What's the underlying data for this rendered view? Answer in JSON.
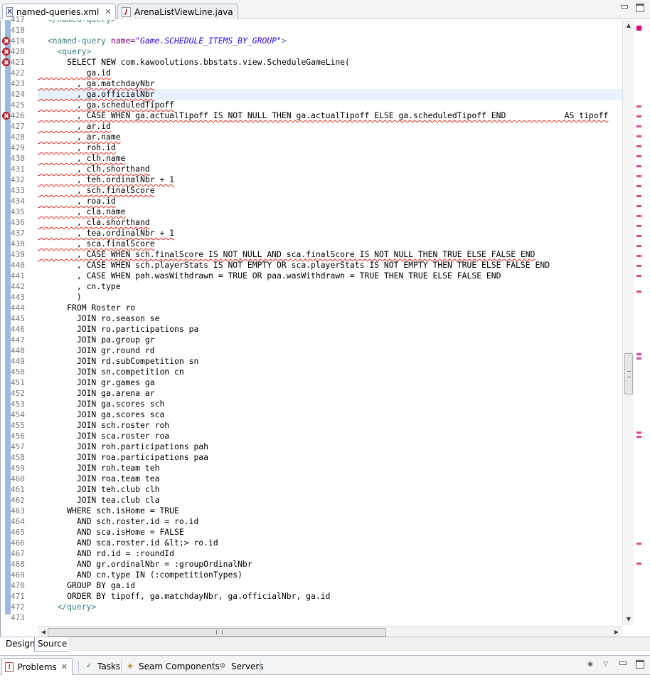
{
  "editor_tabs": [
    {
      "label": "named-queries.xml",
      "icon": "xml-file-icon",
      "active": true
    },
    {
      "label": "ArenaListViewLine.java",
      "icon": "java-file-icon",
      "active": false
    }
  ],
  "lines": [
    {
      "n": "417",
      "err": false,
      "sq": false,
      "text": "  </named-query>"
    },
    {
      "n": "418",
      "err": false,
      "sq": false,
      "text": ""
    },
    {
      "n": "419",
      "err": true,
      "sq": false,
      "kind": "nq-open"
    },
    {
      "n": "420",
      "err": true,
      "sq": false,
      "kind": "query-open"
    },
    {
      "n": "421",
      "err": true,
      "sq": false,
      "text": "      SELECT NEW com.kawoolutions.bbstats.view.ScheduleGameLine("
    },
    {
      "n": "422",
      "err": false,
      "sq": true,
      "text": "          ga.id"
    },
    {
      "n": "423",
      "err": false,
      "sq": true,
      "text": "        , ga.matchdayNbr"
    },
    {
      "n": "424",
      "err": false,
      "sq": true,
      "text": "        , ga.officialNbr"
    },
    {
      "n": "425",
      "err": false,
      "sq": true,
      "text": "        , ga.scheduledTipoff"
    },
    {
      "n": "426",
      "err": true,
      "sq": true,
      "text": "        , CASE WHEN ga.actualTipoff IS NOT NULL THEN ga.actualTipoff ELSE ga.scheduledTipoff END            AS tipoff"
    },
    {
      "n": "427",
      "err": false,
      "sq": true,
      "text": "        , ar.id"
    },
    {
      "n": "428",
      "err": false,
      "sq": true,
      "text": "        , ar.name"
    },
    {
      "n": "429",
      "err": false,
      "sq": true,
      "text": "        , roh.id"
    },
    {
      "n": "430",
      "err": false,
      "sq": true,
      "text": "        , clh.name"
    },
    {
      "n": "431",
      "err": false,
      "sq": true,
      "text": "        , clh.shorthand"
    },
    {
      "n": "432",
      "err": false,
      "sq": true,
      "text": "        , teh.ordinalNbr + 1"
    },
    {
      "n": "433",
      "err": false,
      "sq": true,
      "text": "        , sch.finalScore"
    },
    {
      "n": "434",
      "err": false,
      "sq": true,
      "text": "        , roa.id"
    },
    {
      "n": "435",
      "err": false,
      "sq": true,
      "text": "        , cla.name"
    },
    {
      "n": "436",
      "err": false,
      "sq": true,
      "text": "        , cla.shorthand"
    },
    {
      "n": "437",
      "err": false,
      "sq": true,
      "text": "        , tea.ordinalNbr + 1"
    },
    {
      "n": "438",
      "err": false,
      "sq": true,
      "text": "        , sca.finalScore"
    },
    {
      "n": "439",
      "err": false,
      "sq": true,
      "text": "        , CASE WHEN sch.finalScore IS NOT NULL AND sca.finalScore IS NOT NULL THEN TRUE ELSE FALSE END"
    },
    {
      "n": "440",
      "err": false,
      "sq": false,
      "text": "        , CASE WHEN sch.playerStats IS NOT EMPTY OR sca.playerStats IS NOT EMPTY THEN TRUE ELSE FALSE END"
    },
    {
      "n": "441",
      "err": false,
      "sq": false,
      "text": "        , CASE WHEN pah.wasWithdrawn = TRUE OR paa.wasWithdrawn = TRUE THEN TRUE ELSE FALSE END"
    },
    {
      "n": "442",
      "err": false,
      "sq": false,
      "text": "        , cn.type"
    },
    {
      "n": "443",
      "err": false,
      "sq": false,
      "text": "        )"
    },
    {
      "n": "444",
      "err": false,
      "sq": false,
      "text": "      FROM Roster ro"
    },
    {
      "n": "445",
      "err": false,
      "sq": false,
      "text": "        JOIN ro.season se"
    },
    {
      "n": "446",
      "err": false,
      "sq": false,
      "text": "        JOIN ro.participations pa"
    },
    {
      "n": "447",
      "err": false,
      "sq": false,
      "text": "        JOIN pa.group gr"
    },
    {
      "n": "448",
      "err": false,
      "sq": false,
      "text": "        JOIN gr.round rd"
    },
    {
      "n": "449",
      "err": false,
      "sq": false,
      "text": "        JOIN rd.subCompetition sn"
    },
    {
      "n": "450",
      "err": false,
      "sq": false,
      "text": "        JOIN sn.competition cn"
    },
    {
      "n": "451",
      "err": false,
      "sq": false,
      "text": "        JOIN gr.games ga"
    },
    {
      "n": "452",
      "err": false,
      "sq": false,
      "text": "        JOIN ga.arena ar"
    },
    {
      "n": "453",
      "err": false,
      "sq": false,
      "text": "        JOIN ga.scores sch"
    },
    {
      "n": "454",
      "err": false,
      "sq": false,
      "text": "        JOIN ga.scores sca"
    },
    {
      "n": "455",
      "err": false,
      "sq": false,
      "text": "        JOIN sch.roster roh"
    },
    {
      "n": "456",
      "err": false,
      "sq": false,
      "text": "        JOIN sca.roster roa"
    },
    {
      "n": "457",
      "err": false,
      "sq": false,
      "text": "        JOIN roh.participations pah"
    },
    {
      "n": "458",
      "err": false,
      "sq": false,
      "text": "        JOIN roa.participations paa"
    },
    {
      "n": "459",
      "err": false,
      "sq": false,
      "text": "        JOIN roh.team teh"
    },
    {
      "n": "460",
      "err": false,
      "sq": false,
      "text": "        JOIN roa.team tea"
    },
    {
      "n": "461",
      "err": false,
      "sq": false,
      "text": "        JOIN teh.club clh"
    },
    {
      "n": "462",
      "err": false,
      "sq": false,
      "text": "        JOIN tea.club cla"
    },
    {
      "n": "463",
      "err": false,
      "sq": false,
      "text": "      WHERE sch.isHome = TRUE"
    },
    {
      "n": "464",
      "err": false,
      "sq": false,
      "text": "        AND sch.roster.id = ro.id"
    },
    {
      "n": "465",
      "err": false,
      "sq": false,
      "text": "        AND sca.isHome = FALSE"
    },
    {
      "n": "466",
      "err": false,
      "sq": false,
      "text": "        AND sca.roster.id &lt;> ro.id"
    },
    {
      "n": "467",
      "err": false,
      "sq": false,
      "text": "        AND rd.id = :roundId"
    },
    {
      "n": "468",
      "err": false,
      "sq": false,
      "text": "        AND gr.ordinalNbr = :groupOrdinalNbr"
    },
    {
      "n": "469",
      "err": false,
      "sq": false,
      "text": "        AND cn.type IN (:competitionTypes)"
    },
    {
      "n": "470",
      "err": false,
      "sq": false,
      "text": "      GROUP BY ga.id"
    },
    {
      "n": "471",
      "err": false,
      "sq": false,
      "text": "      ORDER BY tipoff, ga.matchdayNbr, ga.officialNbr, ga.id"
    },
    {
      "n": "472",
      "err": false,
      "sq": false,
      "kind": "query-close"
    },
    {
      "n": "473",
      "err": false,
      "sq": false,
      "kind": "nq-close"
    }
  ],
  "xml": {
    "nq_open_tag": "<named-query",
    "nq_attr": " name=",
    "nq_value": "\"Game.SCHEDULE_ITEMS_BY_GROUP\"",
    "nq_gt": ">",
    "query_open": "<query>",
    "query_close": "</query>",
    "nq_close": "</named-query>"
  },
  "current_line_index": 7,
  "mode_tabs": {
    "design": "Design",
    "source": "Source"
  },
  "view_tabs": [
    {
      "label": "Problems",
      "icon": "problems-icon",
      "active": true
    },
    {
      "label": "Tasks",
      "icon": "tasks-icon",
      "active": false
    },
    {
      "label": "Seam Components",
      "icon": "seam-components-icon",
      "active": false
    },
    {
      "label": "Servers",
      "icon": "servers-icon",
      "active": false
    }
  ],
  "colors": {
    "error": "#d8262b",
    "xml_tag": "#3f7f7f",
    "xml_attr": "#7f007f",
    "xml_value": "#2a00ff",
    "overview_mark": "#e4419a"
  }
}
